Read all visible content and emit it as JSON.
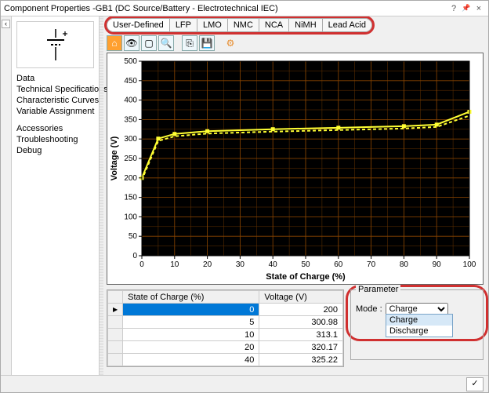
{
  "window": {
    "title": "Component Properties -GB1 (DC Source/Battery - Electrotechnical IEC)",
    "help_btn": "?",
    "pin_btn": "📌",
    "close_btn": "×"
  },
  "sidebar": {
    "items": [
      {
        "label": "Data"
      },
      {
        "label": "Technical Specifications"
      },
      {
        "label": "Characteristic Curves"
      },
      {
        "label": "Variable Assignment"
      }
    ],
    "items2": [
      {
        "label": "Accessories"
      },
      {
        "label": "Troubleshooting"
      },
      {
        "label": "Debug"
      }
    ]
  },
  "tabs": [
    {
      "label": "User-Defined",
      "active": true
    },
    {
      "label": "LFP"
    },
    {
      "label": "LMO"
    },
    {
      "label": "NMC"
    },
    {
      "label": "NCA"
    },
    {
      "label": "NiMH"
    },
    {
      "label": "Lead Acid"
    }
  ],
  "toolbar": {
    "home_icon": "⌂",
    "eye_icon": "👁",
    "box_icon": "▢",
    "zoom_icon": "🔍",
    "copy_icon": "⎘",
    "save_icon": "💾",
    "gear_icon": "⚙"
  },
  "chart_data": {
    "type": "line",
    "title": "",
    "xlabel": "State of Charge (%)",
    "ylabel": "Voltage (V)",
    "xlim": [
      0,
      100
    ],
    "ylim": [
      0,
      500
    ],
    "xticks": [
      0,
      10,
      20,
      30,
      40,
      50,
      60,
      70,
      80,
      90,
      100
    ],
    "yticks": [
      0,
      50,
      100,
      150,
      200,
      250,
      300,
      350,
      400,
      450,
      500
    ],
    "series": [
      {
        "name": "Charge",
        "color": "#ffff33",
        "style": "solid",
        "x": [
          0,
          5,
          10,
          20,
          40,
          60,
          80,
          90,
          100
        ],
        "values": [
          200,
          300.98,
          313.1,
          320.17,
          325.22,
          329.0,
          333.0,
          337.0,
          370.0
        ]
      },
      {
        "name": "Discharge",
        "color": "#ffff33",
        "style": "dashed",
        "x": [
          0,
          5,
          10,
          20,
          40,
          60,
          80,
          90,
          100
        ],
        "values": [
          195,
          295,
          307,
          314,
          319,
          323,
          327,
          331,
          360
        ]
      }
    ],
    "grid": true
  },
  "table": {
    "columns": [
      "State of Charge (%)",
      "Voltage (V)"
    ],
    "rows": [
      {
        "soc": "0",
        "v": "200",
        "selected": true
      },
      {
        "soc": "5",
        "v": "300.98"
      },
      {
        "soc": "10",
        "v": "313.1"
      },
      {
        "soc": "20",
        "v": "320.17"
      },
      {
        "soc": "40",
        "v": "325.22"
      }
    ]
  },
  "parameter": {
    "group_label": "Parameter",
    "mode_label": "Mode :",
    "mode_value": "Charge",
    "mode_options": [
      "Charge",
      "Discharge"
    ]
  },
  "footer": {
    "ok": "✓"
  }
}
